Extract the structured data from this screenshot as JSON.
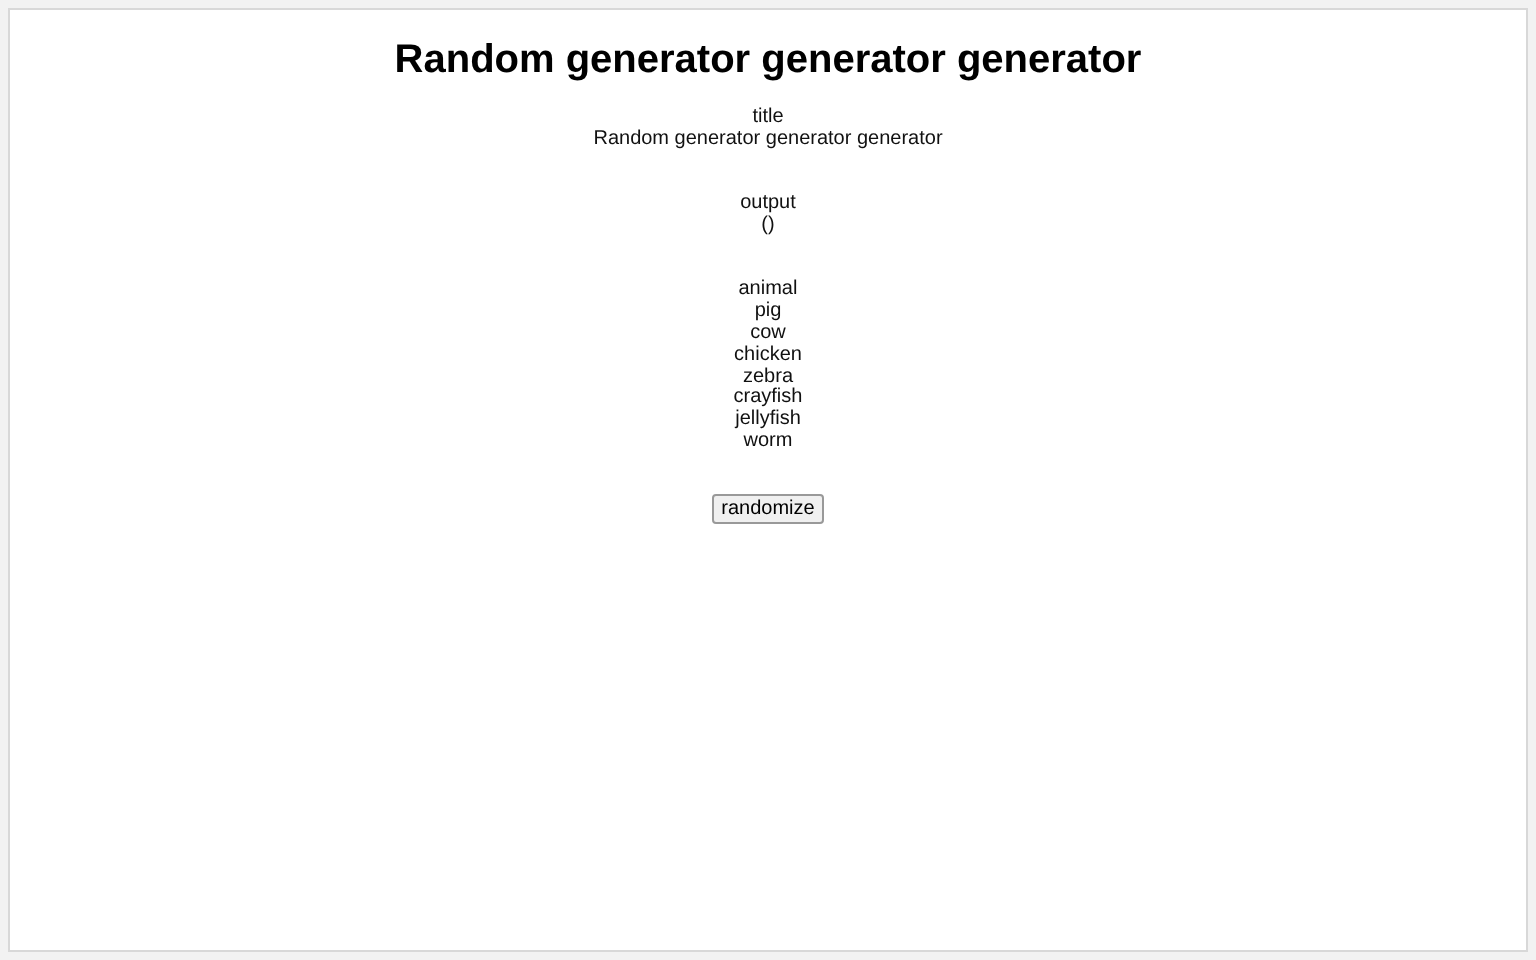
{
  "heading": "Random generator generator generator",
  "sections": [
    {
      "label": "title",
      "lines": [
        "Random generator generator generator"
      ]
    },
    {
      "label": "output",
      "lines": [
        "()"
      ]
    },
    {
      "label": "animal",
      "lines": [
        "pig",
        "cow",
        "chicken",
        "zebra",
        "crayfish",
        "jellyfish",
        "worm"
      ]
    }
  ],
  "button": "randomize"
}
